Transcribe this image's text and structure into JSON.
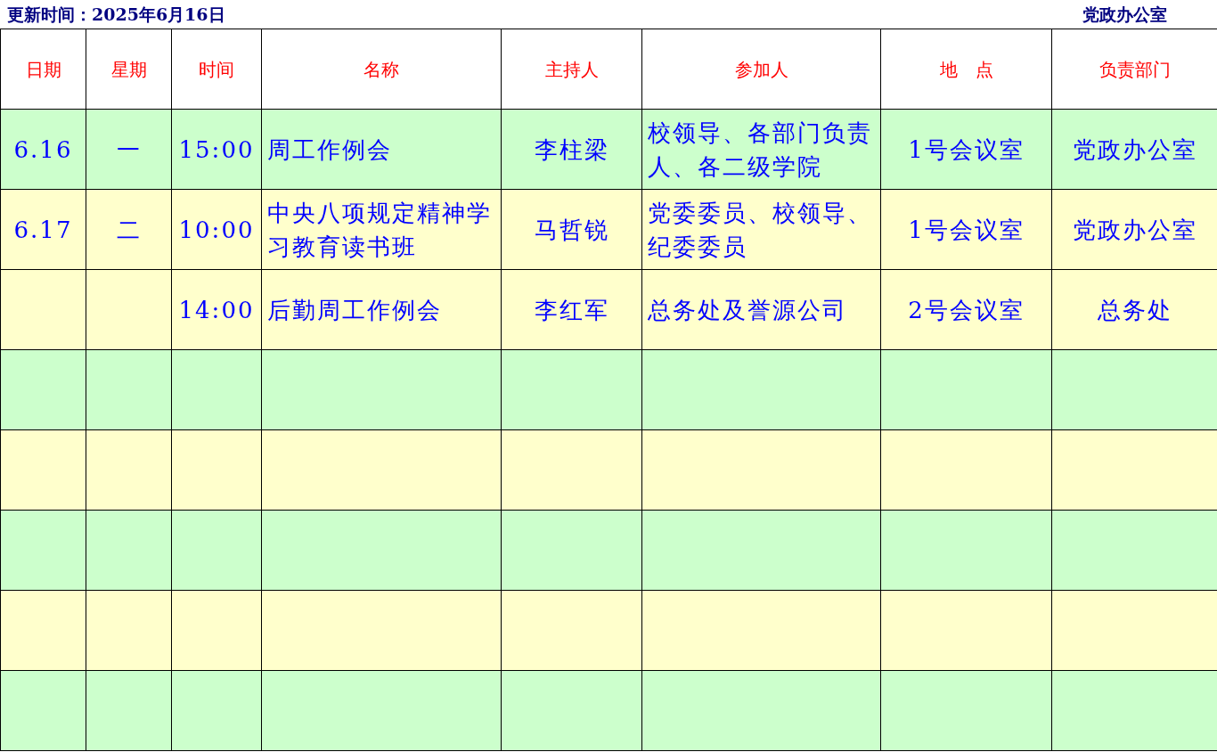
{
  "top_bar": {
    "updated": "更新时间：2025年6月16日",
    "office": "党政办公室"
  },
  "table": {
    "columns": [
      "日期",
      "星期",
      "时间",
      "名称",
      "主持人",
      "参加人",
      "地　点",
      "负责部门"
    ],
    "rows": [
      {
        "color": "#ccffcc",
        "date": "6.16",
        "weekday": "一",
        "time": "15:00",
        "name": "周工作例会",
        "host": "李柱梁",
        "attendees": "校领导、各部门负责人、各二级学院",
        "location": "1号会议室",
        "department": "党政办公室"
      },
      {
        "color": "#ffffcc",
        "date": "6.17",
        "weekday": "二",
        "time": "10:00",
        "name": "中央八项规定精神学习教育读书班",
        "host": "马哲锐",
        "attendees": "党委委员、校领导、纪委委员",
        "location": "1号会议室",
        "department": "党政办公室"
      },
      {
        "color": "#ffffcc",
        "time": "14:00",
        "name": "后勤周工作例会",
        "host": "李红军",
        "attendees": "总务处及誉源公司",
        "location": "2号会议室",
        "department": "总务处"
      },
      {
        "color": "#ccffcc"
      },
      {
        "color": "#ffffcc"
      },
      {
        "color": "#ccffcc"
      },
      {
        "color": "#ffffcc"
      },
      {
        "color": "#ccffcc"
      }
    ]
  }
}
